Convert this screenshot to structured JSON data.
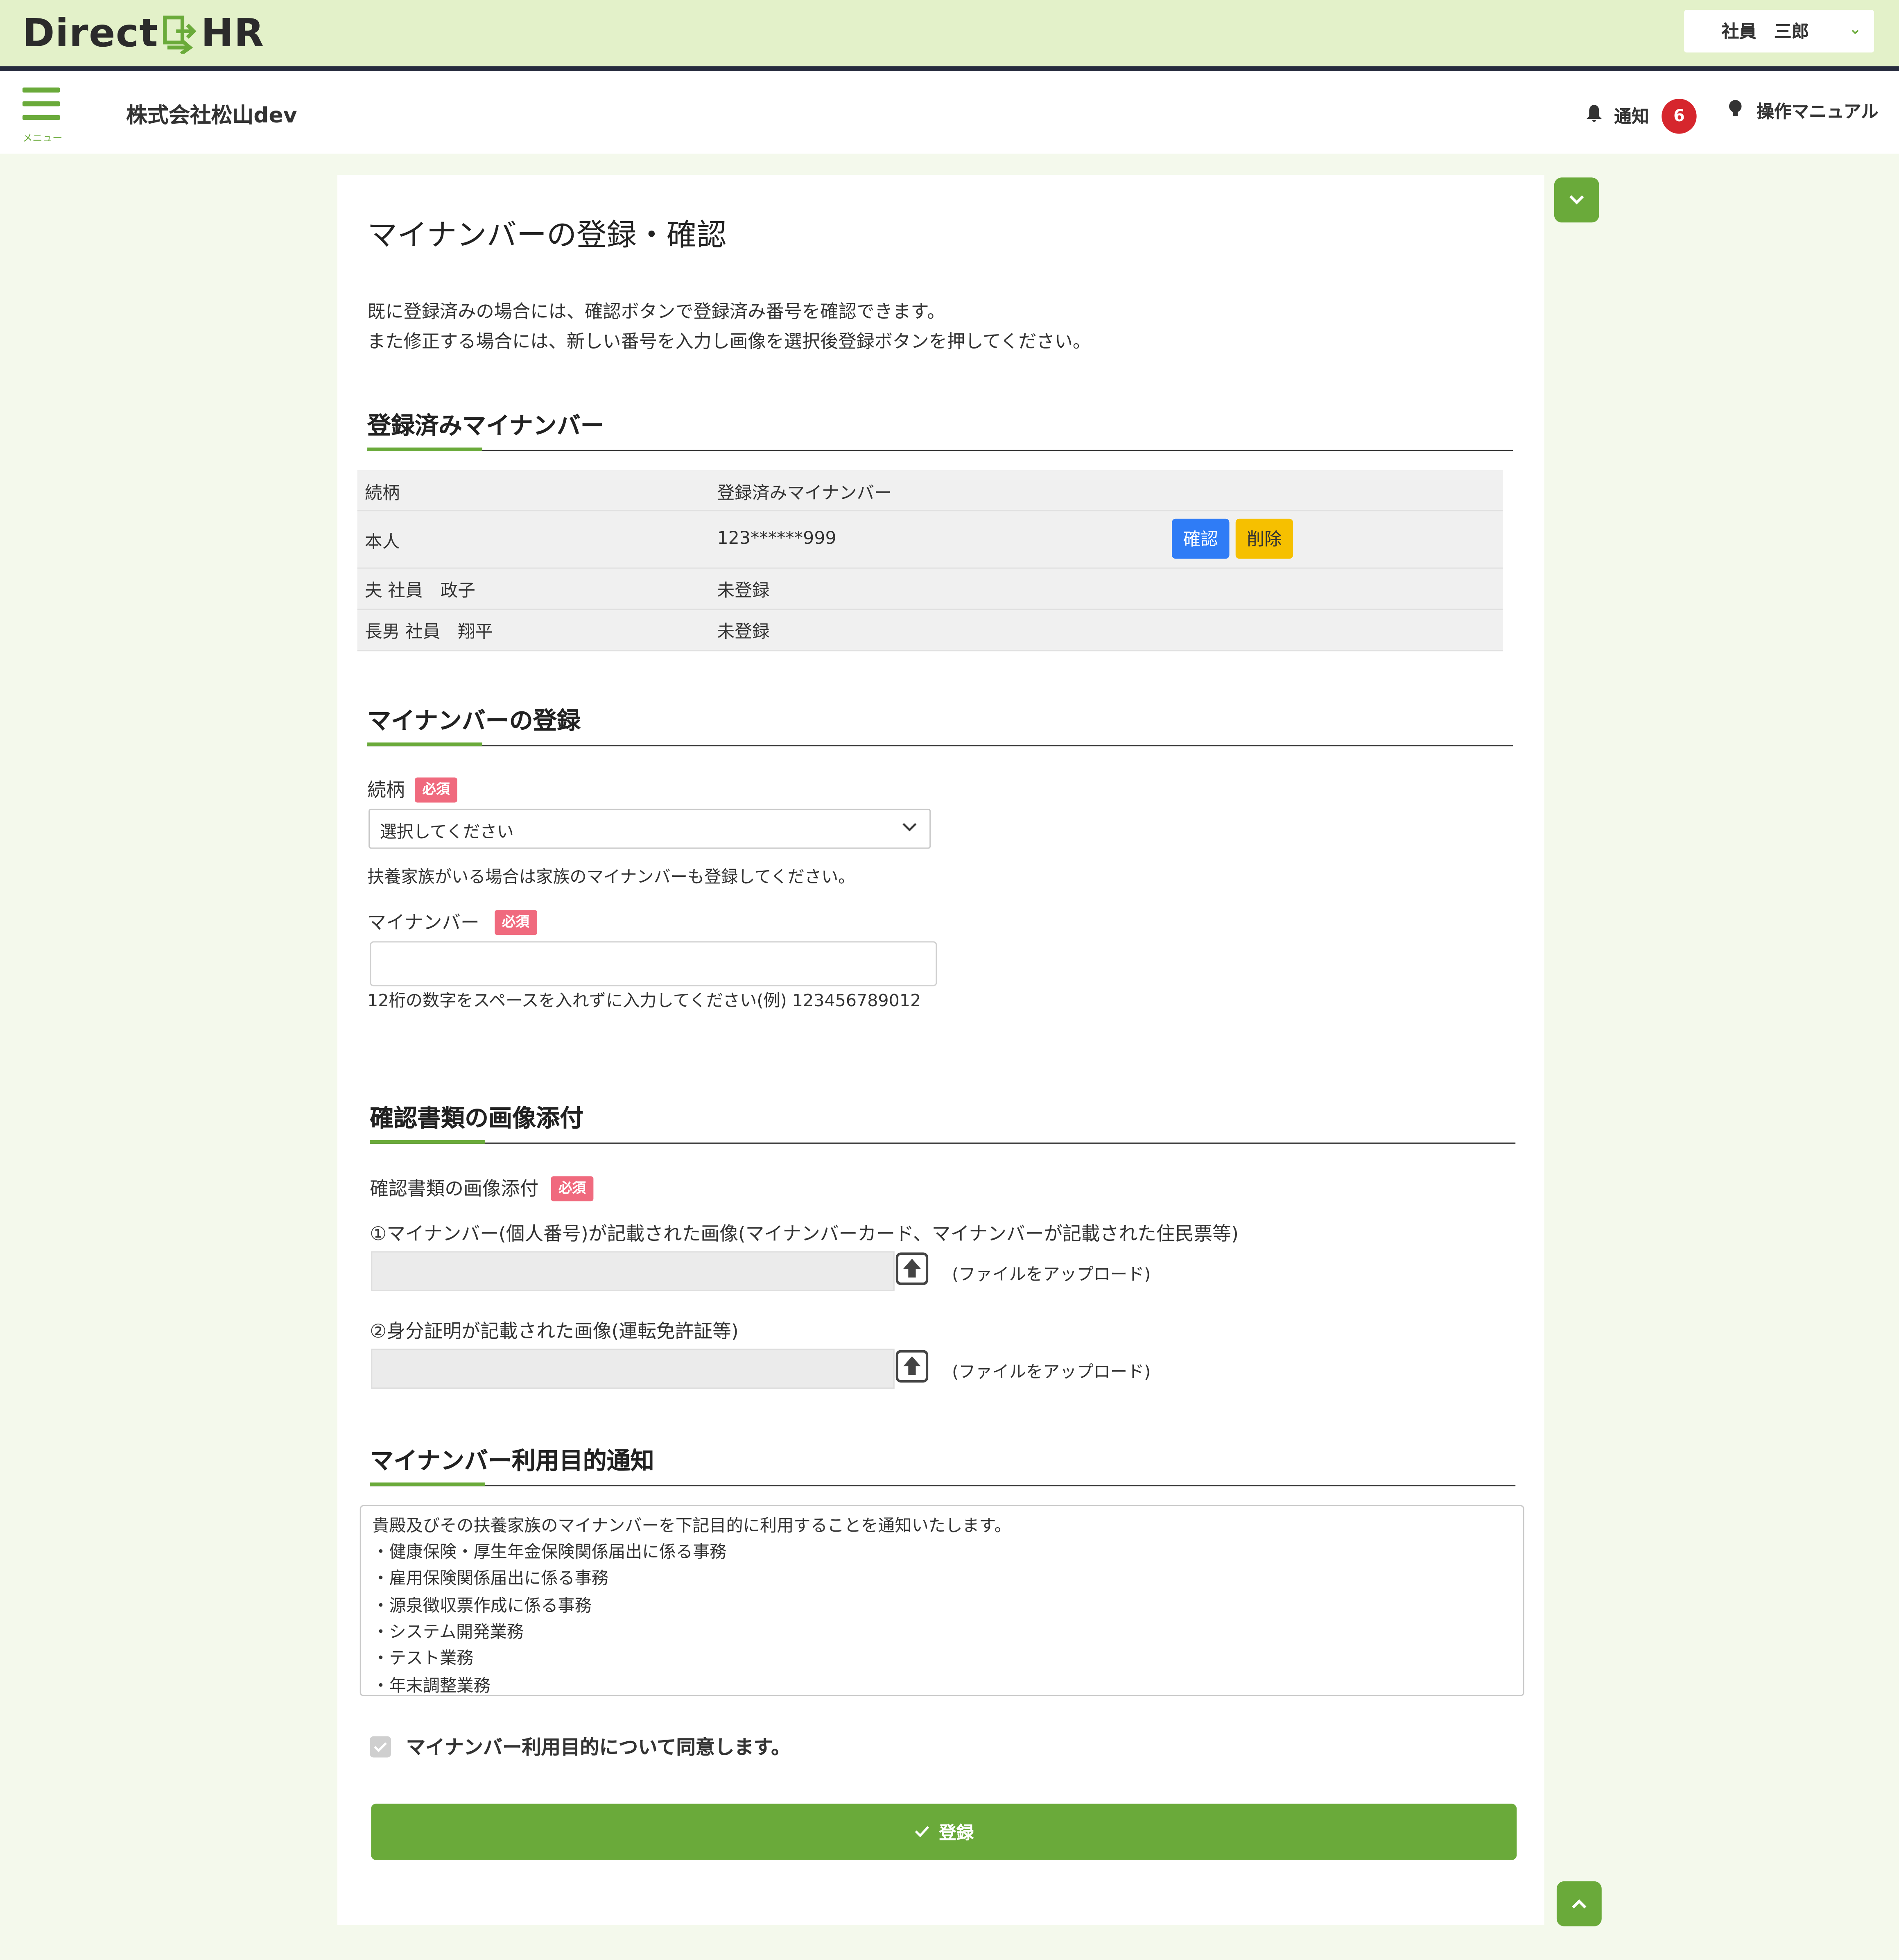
{
  "header": {
    "logo_left": "Direct",
    "logo_right": "HR",
    "user_name": "社員　三郎",
    "menu_label": "メニュー",
    "company_name": "株式会社松山dev",
    "notify_label": "通知",
    "notify_count": "6",
    "manual_label": "操作マニュアル"
  },
  "page": {
    "title": "マイナンバーの登録・確認",
    "intro_line1": "既に登録済みの場合には、確認ボタンで登録済み番号を確認できます。",
    "intro_line2": "また修正する場合には、新しい番号を入力し画像を選択後登録ボタンを押してください。"
  },
  "registered": {
    "heading": "登録済みマイナンバー",
    "columns": [
      "続柄",
      "登録済みマイナンバー"
    ],
    "rows": [
      {
        "relation": "本人",
        "number": "123******999"
      },
      {
        "relation": "夫 社員　政子",
        "number": "未登録"
      },
      {
        "relation": "長男 社員　翔平",
        "number": "未登録"
      }
    ],
    "confirm_label": "確認",
    "delete_label": "削除"
  },
  "registration": {
    "heading": "マイナンバーの登録",
    "relation_label": "続柄",
    "required_label": "必須",
    "relation_selected": "選択してください",
    "relation_help": "扶養家族がいる場合は家族のマイナンバーも登録してください。",
    "number_label": "マイナンバー",
    "number_value": "",
    "number_help": "12桁の数字をスペースを入れずに入力してください(例) 123456789012"
  },
  "documents": {
    "heading": "確認書類の画像添付",
    "label": "確認書類の画像添付",
    "item1_label": "①マイナンバー(個人番号)が記載された画像(マイナンバーカード、マイナンバーが記載された住民票等)",
    "item2_label": "②身分証明が記載された画像(運転免許証等)",
    "upload_text": "(ファイルをアップロード)"
  },
  "purpose": {
    "heading": "マイナンバー利用目的通知",
    "lines": [
      "貴殿及びその扶養家族のマイナンバーを下記目的に利用することを通知いたします。",
      "・健康保険・厚生年金保険関係届出に係る事務",
      "・雇用保険関係届出に係る事務",
      "・源泉徴収票作成に係る事務",
      "・システム開発業務",
      "・テスト業務",
      "・年末調整業務"
    ],
    "agree_label": "マイナンバー利用目的について同意します。",
    "agree_checked": true
  },
  "submit_label": "登録",
  "colors": {
    "accent": "#6aaa3a",
    "header_bg": "#e3f1c9",
    "confirm_blue": "#2f7cf6",
    "delete_yellow": "#f6c000",
    "required_pink": "#f06a7e",
    "badge_red": "#d6262d"
  },
  "icons": [
    "logo-mark-icon",
    "chevron-down-icon",
    "hamburger-icon",
    "bell-icon",
    "lightbulb-icon",
    "upload-icon",
    "check-icon",
    "chevron-up-icon"
  ]
}
